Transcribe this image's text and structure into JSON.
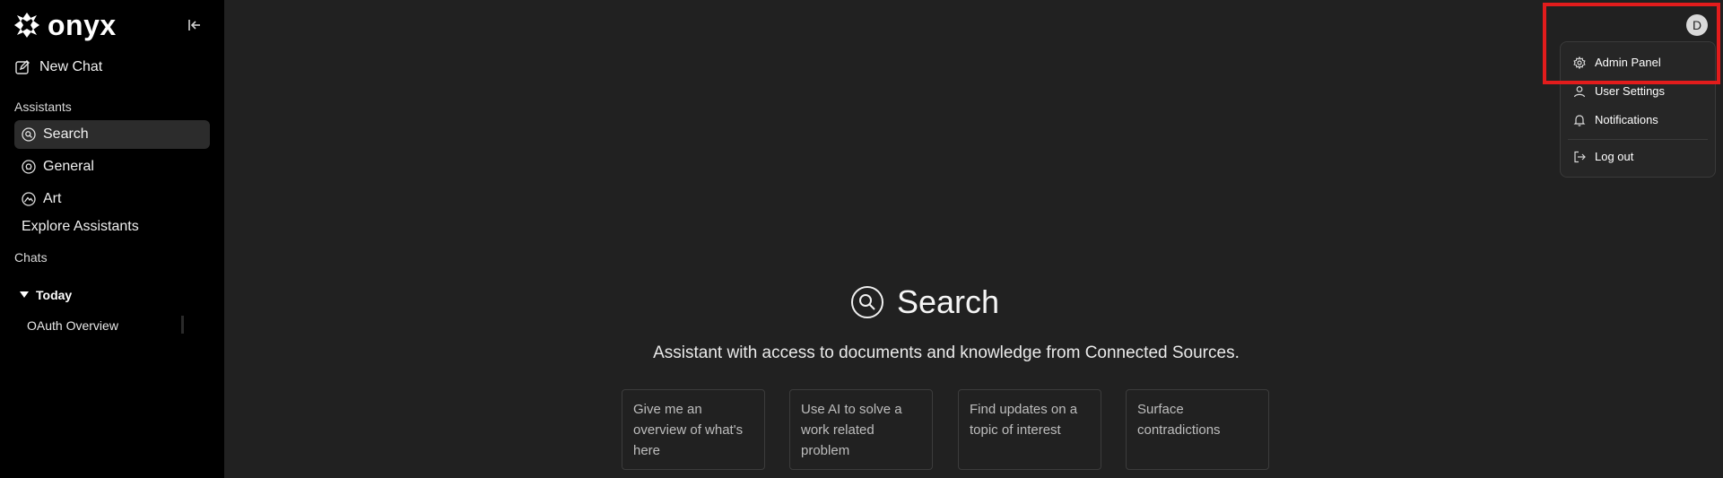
{
  "app": {
    "name": "onyx"
  },
  "sidebar": {
    "new_chat_label": "New Chat",
    "assistants_heading": "Assistants",
    "assistants": [
      {
        "label": "Search",
        "icon": "search-icon",
        "active": true
      },
      {
        "label": "General",
        "icon": "lightbulb-icon",
        "active": false
      },
      {
        "label": "Art",
        "icon": "palette-icon",
        "active": false
      }
    ],
    "explore_label": "Explore Assistants",
    "chats_heading": "Chats",
    "today_label": "Today",
    "chats": [
      {
        "label": "OAuth Overview"
      }
    ]
  },
  "user": {
    "avatar_letter": "D"
  },
  "user_menu": {
    "items": [
      {
        "label": "Admin Panel",
        "icon": "gear-icon"
      },
      {
        "label": "User Settings",
        "icon": "user-icon"
      },
      {
        "label": "Notifications",
        "icon": "bell-icon"
      },
      {
        "label": "Log out",
        "icon": "logout-icon"
      }
    ]
  },
  "main": {
    "title": "Search",
    "description": "Assistant with access to documents and knowledge from Connected Sources.",
    "starters": [
      {
        "text": "Give me an overview of what's here"
      },
      {
        "text": "Use AI to solve a work related problem"
      },
      {
        "text": "Find updates on a topic of interest"
      },
      {
        "text": "Surface contradictions"
      }
    ]
  },
  "colors": {
    "sidebar_bg": "#000000",
    "main_bg": "#212121",
    "highlight": "#e21c1c",
    "menu_bg": "#262626"
  }
}
